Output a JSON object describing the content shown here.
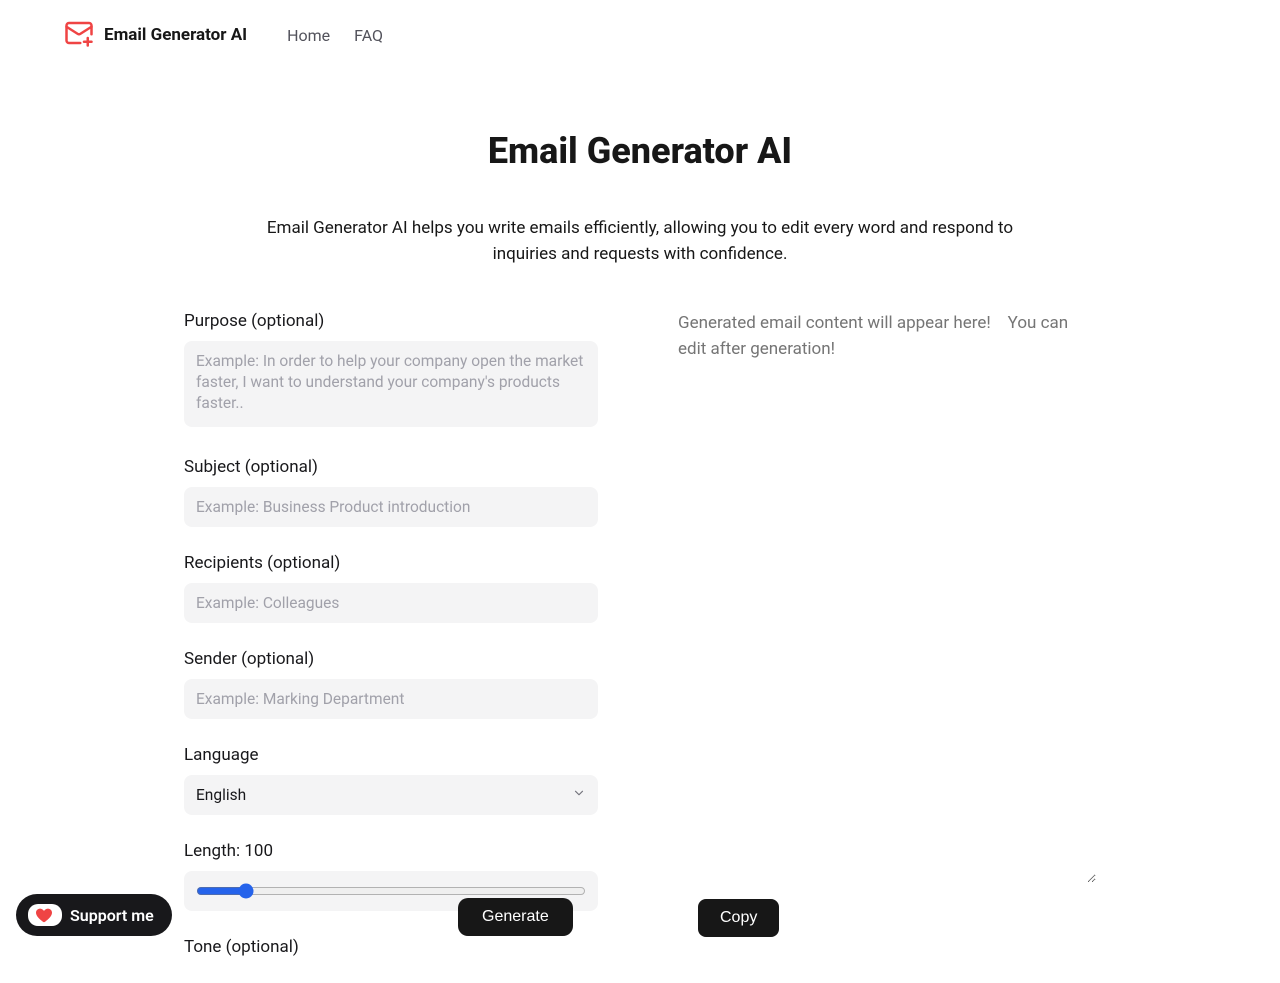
{
  "header": {
    "brand": "Email Generator AI",
    "nav": {
      "home": "Home",
      "faq": "FAQ"
    }
  },
  "hero": {
    "title": "Email Generator AI",
    "subtitle": "Email Generator AI helps you write emails efficiently, allowing you to edit every word and respond to inquiries and requests with confidence."
  },
  "form": {
    "purpose": {
      "label": "Purpose (optional)",
      "placeholder": "Example: In order to help your company open the market faster, I want to understand your company's products faster.."
    },
    "subject": {
      "label": "Subject (optional)",
      "placeholder": "Example: Business Product introduction"
    },
    "recipients": {
      "label": "Recipients (optional)",
      "placeholder": "Example: Colleagues"
    },
    "sender": {
      "label": "Sender (optional)",
      "placeholder": "Example: Marking Department"
    },
    "language": {
      "label": "Language",
      "selected": "English"
    },
    "length": {
      "label": "Length: 100",
      "value": "100",
      "min": "50",
      "max": "500"
    },
    "tone": {
      "label": "Tone (optional)"
    }
  },
  "output": {
    "placeholder": "Generated email content will appear here!    You can edit after generation!"
  },
  "buttons": {
    "generate": "Generate",
    "copy": "Copy",
    "support": "Support me"
  },
  "colors": {
    "accent_red": "#ef4444",
    "bg_gray": "#f4f4f5",
    "text_muted": "#a1a1aa",
    "slider_blue": "#2563eb",
    "button_dark": "#171717"
  }
}
